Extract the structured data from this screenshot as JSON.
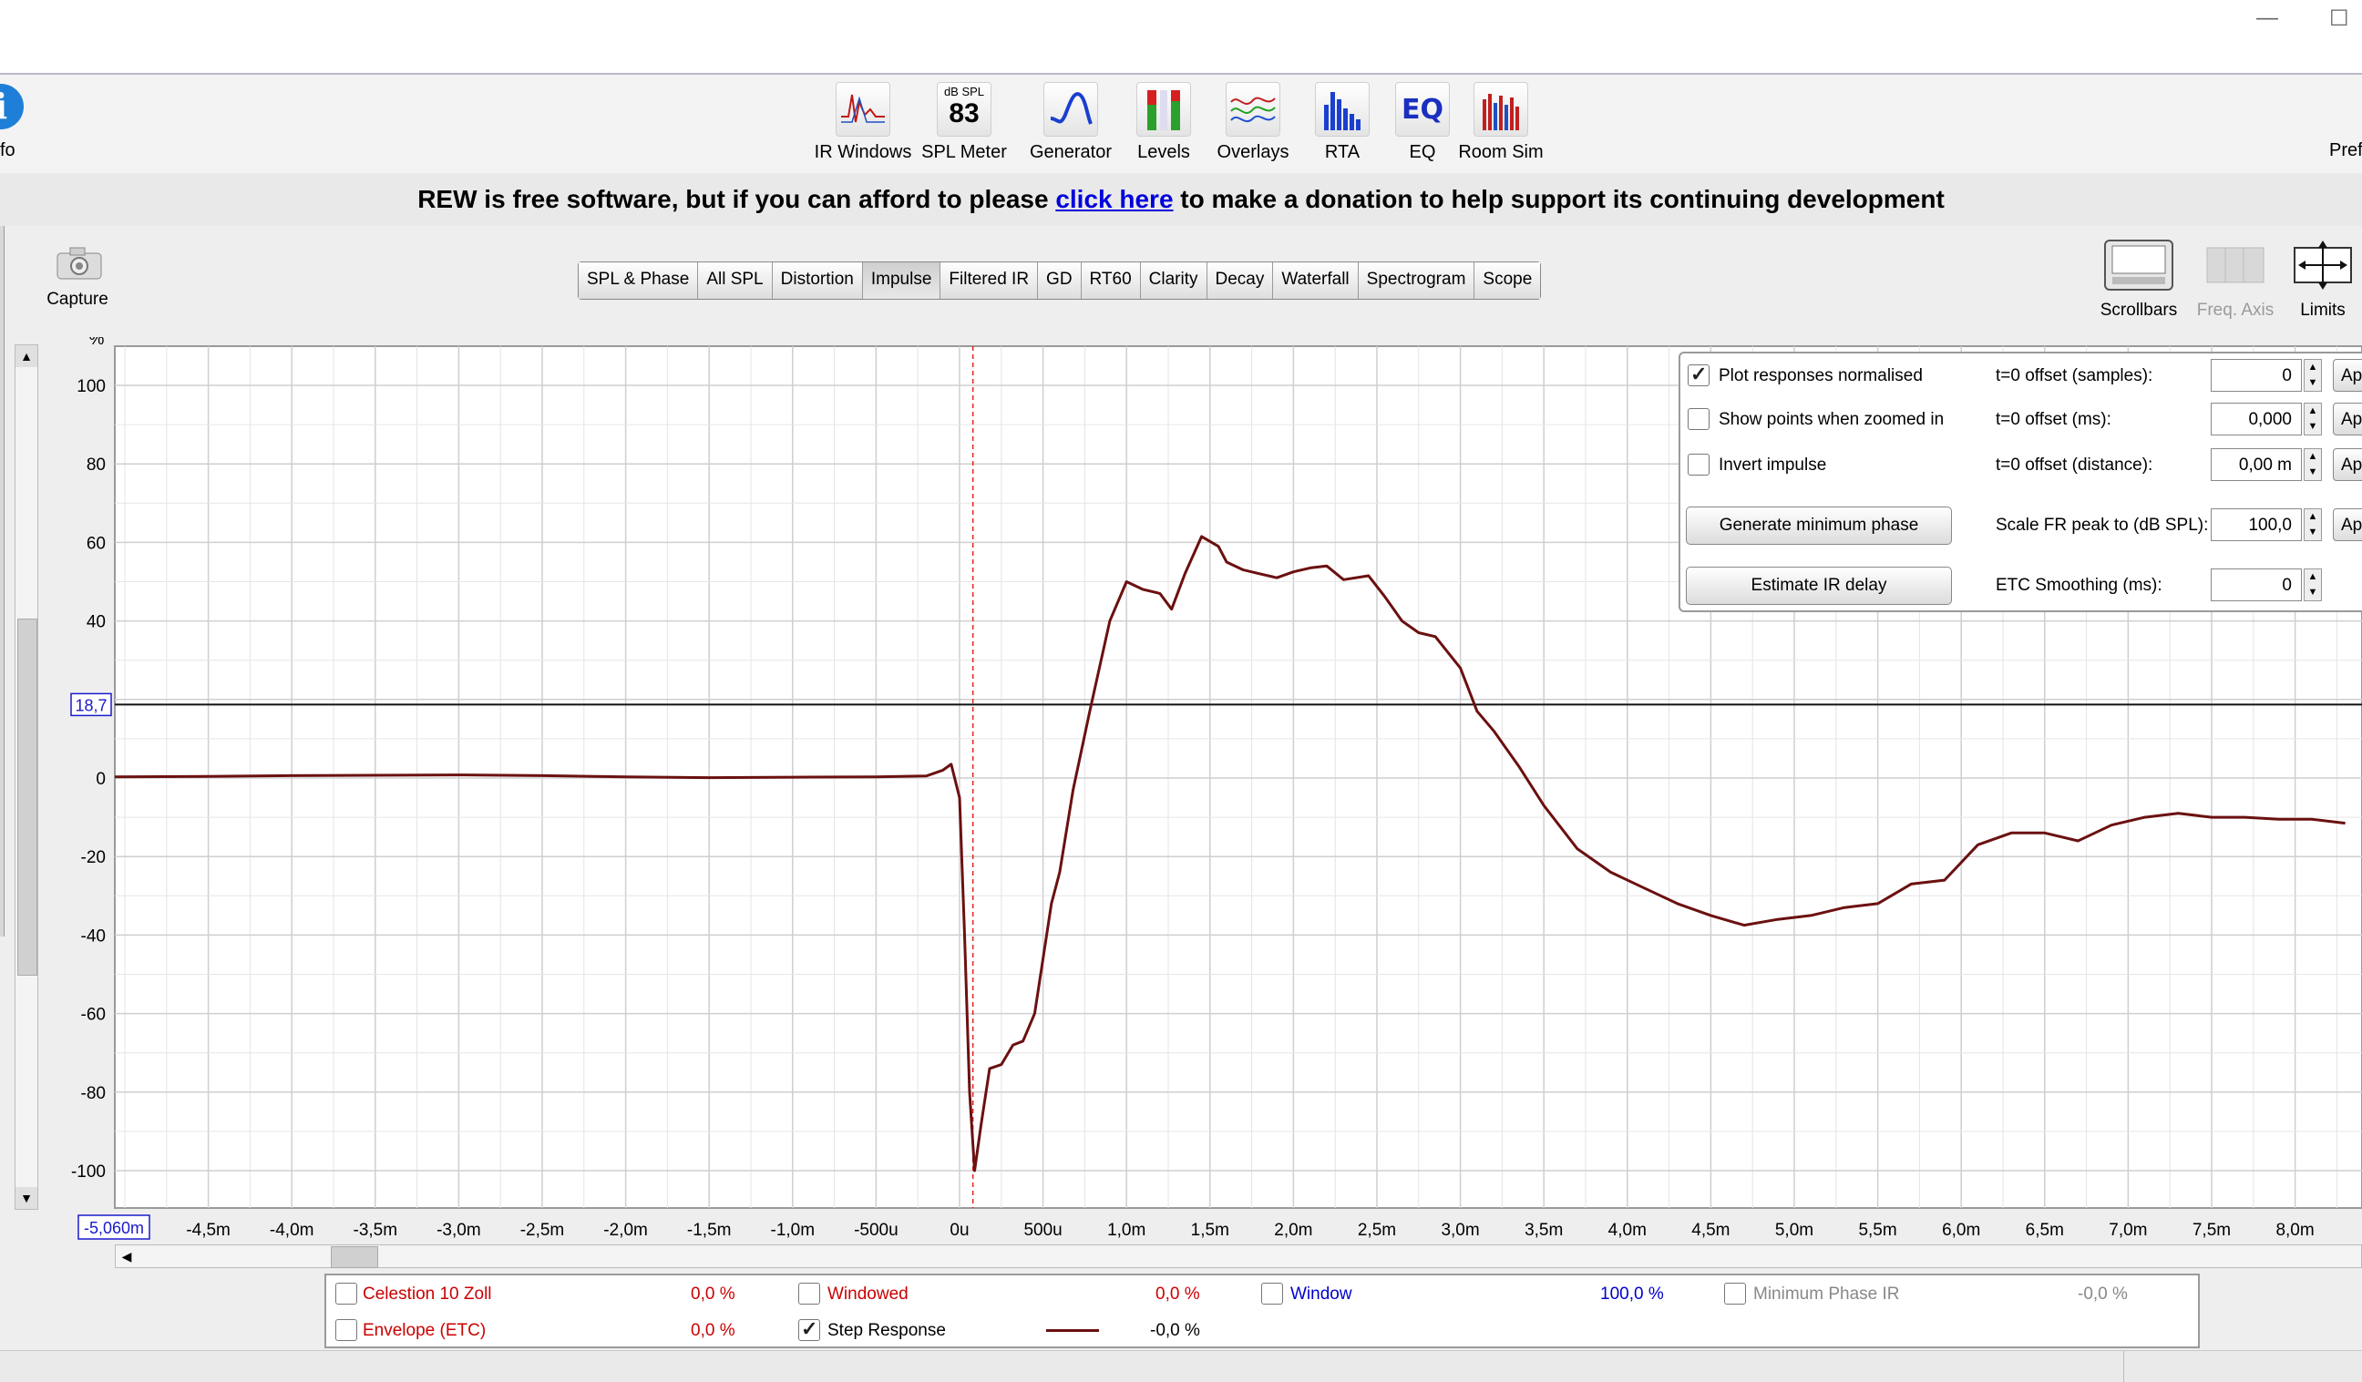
{
  "window": {
    "minimize": "—",
    "maximize": "☐"
  },
  "toolbar": {
    "info_label": "fo",
    "prefs_label": "Pref",
    "items": [
      {
        "label": "IR Windows",
        "icon": "ir-windows-icon"
      },
      {
        "label": "SPL Meter",
        "icon": "spl-meter-icon",
        "icon_top": "dB SPL",
        "icon_value": "83"
      },
      {
        "label": "Generator",
        "icon": "generator-icon"
      },
      {
        "label": "Levels",
        "icon": "levels-icon"
      },
      {
        "label": "Overlays",
        "icon": "overlays-icon"
      },
      {
        "label": "RTA",
        "icon": "rta-icon"
      },
      {
        "label": "EQ",
        "icon": "eq-icon",
        "icon_text": "EQ"
      },
      {
        "label": "Room Sim",
        "icon": "room-sim-icon"
      }
    ]
  },
  "banner": {
    "before": "REW is free software, but if you can afford to please ",
    "link": "click here",
    "after": " to make a donation to help support its continuing development"
  },
  "capture": {
    "label": "Capture"
  },
  "tabs": [
    {
      "label": "SPL & Phase",
      "active": false
    },
    {
      "label": "All SPL",
      "active": false
    },
    {
      "label": "Distortion",
      "active": false
    },
    {
      "label": "Impulse",
      "active": true
    },
    {
      "label": "Filtered IR",
      "active": false
    },
    {
      "label": "GD",
      "active": false
    },
    {
      "label": "RT60",
      "active": false
    },
    {
      "label": "Clarity",
      "active": false
    },
    {
      "label": "Decay",
      "active": false
    },
    {
      "label": "Waterfall",
      "active": false
    },
    {
      "label": "Spectrogram",
      "active": false
    },
    {
      "label": "Scope",
      "active": false
    }
  ],
  "right_tools": {
    "scrollbars": "Scrollbars",
    "freq_axis": "Freq. Axis",
    "limits": "Limits"
  },
  "controls": {
    "plot_normalised": {
      "label": "Plot responses normalised",
      "checked": true
    },
    "show_points": {
      "label": "Show points when zoomed in",
      "checked": false
    },
    "invert": {
      "label": "Invert impulse",
      "checked": false
    },
    "gen_min_phase": "Generate minimum phase",
    "estimate_delay": "Estimate IR delay",
    "offset_samples": {
      "label": "t=0 offset (samples):",
      "value": "0"
    },
    "offset_ms": {
      "label": "t=0 offset (ms):",
      "value": "0,000"
    },
    "offset_distance": {
      "label": "t=0 offset (distance):",
      "value": "0,00 m"
    },
    "scale_fr": {
      "label": "Scale FR peak to (dB SPL):",
      "value": "100,0"
    },
    "etc_smoothing": {
      "label": "ETC Smoothing (ms):",
      "value": "0"
    },
    "apply_label": "Ap"
  },
  "legend": {
    "items": [
      {
        "name": "Celestion  10 Zoll",
        "value": "0,0 %",
        "checked": false,
        "color": "#cc0000"
      },
      {
        "name": "Envelope (ETC)",
        "value": "0,0 %",
        "checked": false,
        "color": "#cc0000"
      },
      {
        "name": "Windowed",
        "value": "0,0 %",
        "checked": false,
        "color": "#cc0000"
      },
      {
        "name": "Step Response",
        "value": "-0,0 %",
        "checked": true,
        "color": "#000000"
      },
      {
        "name": "Window",
        "value": "100,0 %",
        "checked": false,
        "color": "#0000cc"
      },
      {
        "name": "Minimum Phase IR",
        "value": "-0,0 %",
        "checked": false,
        "color": "#888888"
      }
    ]
  },
  "chart_data": {
    "type": "line",
    "ylabel": "%",
    "ylim": [
      -110,
      110
    ],
    "xlim": [
      -5.06,
      8.3
    ],
    "x_unit": "ms",
    "cursor_y": "18,7",
    "cursor_x": "-5,060m",
    "y_ticks": [
      "100",
      "80",
      "60",
      "40",
      "0",
      "-20",
      "-40",
      "-60",
      "-80",
      "-100"
    ],
    "y_tick_values": [
      100,
      80,
      60,
      40,
      0,
      -20,
      -40,
      -60,
      -80,
      -100
    ],
    "x_ticks": [
      "-4,5m",
      "-4,0m",
      "-3,5m",
      "-3,0m",
      "-2,5m",
      "-2,0m",
      "-1,5m",
      "-1,0m",
      "-500u",
      "0u",
      "500u",
      "1,0m",
      "1,5m",
      "2,0m",
      "2,5m",
      "3,0m",
      "3,5m",
      "4,0m",
      "4,5m",
      "5,0m",
      "5,5m",
      "6,0m",
      "6,5m",
      "7,0m",
      "7,5m",
      "8,0m"
    ],
    "x_tick_values": [
      -4.5,
      -4.0,
      -3.5,
      -3.0,
      -2.5,
      -2.0,
      -1.5,
      -1.0,
      -0.5,
      0.0,
      0.5,
      1.0,
      1.5,
      2.0,
      2.5,
      3.0,
      3.5,
      4.0,
      4.5,
      5.0,
      5.5,
      6.0,
      6.5,
      7.0,
      7.5,
      8.0
    ],
    "grid": true,
    "cursor_line_y": 18.7,
    "peak_marker_x": 0.08,
    "series": [
      {
        "name": "Step Response",
        "color": "#6b1010",
        "x": [
          -5.06,
          -4.5,
          -4.0,
          -3.5,
          -3.0,
          -2.5,
          -2.0,
          -1.5,
          -1.0,
          -0.5,
          -0.2,
          -0.1,
          -0.05,
          0.0,
          0.03,
          0.06,
          0.09,
          0.13,
          0.18,
          0.25,
          0.32,
          0.38,
          0.45,
          0.5,
          0.55,
          0.6,
          0.68,
          0.78,
          0.9,
          1.0,
          1.1,
          1.2,
          1.27,
          1.35,
          1.45,
          1.55,
          1.6,
          1.7,
          1.8,
          1.9,
          2.0,
          2.1,
          2.2,
          2.3,
          2.45,
          2.55,
          2.65,
          2.75,
          2.85,
          3.0,
          3.1,
          3.2,
          3.35,
          3.5,
          3.7,
          3.9,
          4.1,
          4.3,
          4.5,
          4.7,
          4.9,
          5.1,
          5.3,
          5.5,
          5.7,
          5.9,
          6.1,
          6.3,
          6.5,
          6.7,
          6.9,
          7.1,
          7.3,
          7.5,
          7.7,
          7.9,
          8.1,
          8.3
        ],
        "y": [
          0.3,
          0.4,
          0.6,
          0.7,
          0.8,
          0.6,
          0.3,
          0.1,
          0.2,
          0.3,
          0.5,
          2,
          3.5,
          -5,
          -40,
          -80,
          -100,
          -88,
          -74,
          -73,
          -68,
          -67,
          -60,
          -46,
          -32,
          -24,
          -3,
          17,
          40,
          50,
          48,
          47,
          43,
          52,
          61.5,
          59,
          55,
          53,
          52,
          51,
          52.5,
          53.5,
          54,
          50.5,
          51.5,
          46,
          40,
          37,
          36,
          28,
          17,
          12,
          3,
          -7,
          -18,
          -24,
          -28,
          -32,
          -35,
          -37.5,
          -36,
          -35,
          -33,
          -32,
          -27,
          -26,
          -17,
          -14,
          -14,
          -16,
          -12,
          -10,
          -9,
          -10,
          -10,
          -10.5,
          -10.5,
          -11.5
        ]
      }
    ]
  }
}
